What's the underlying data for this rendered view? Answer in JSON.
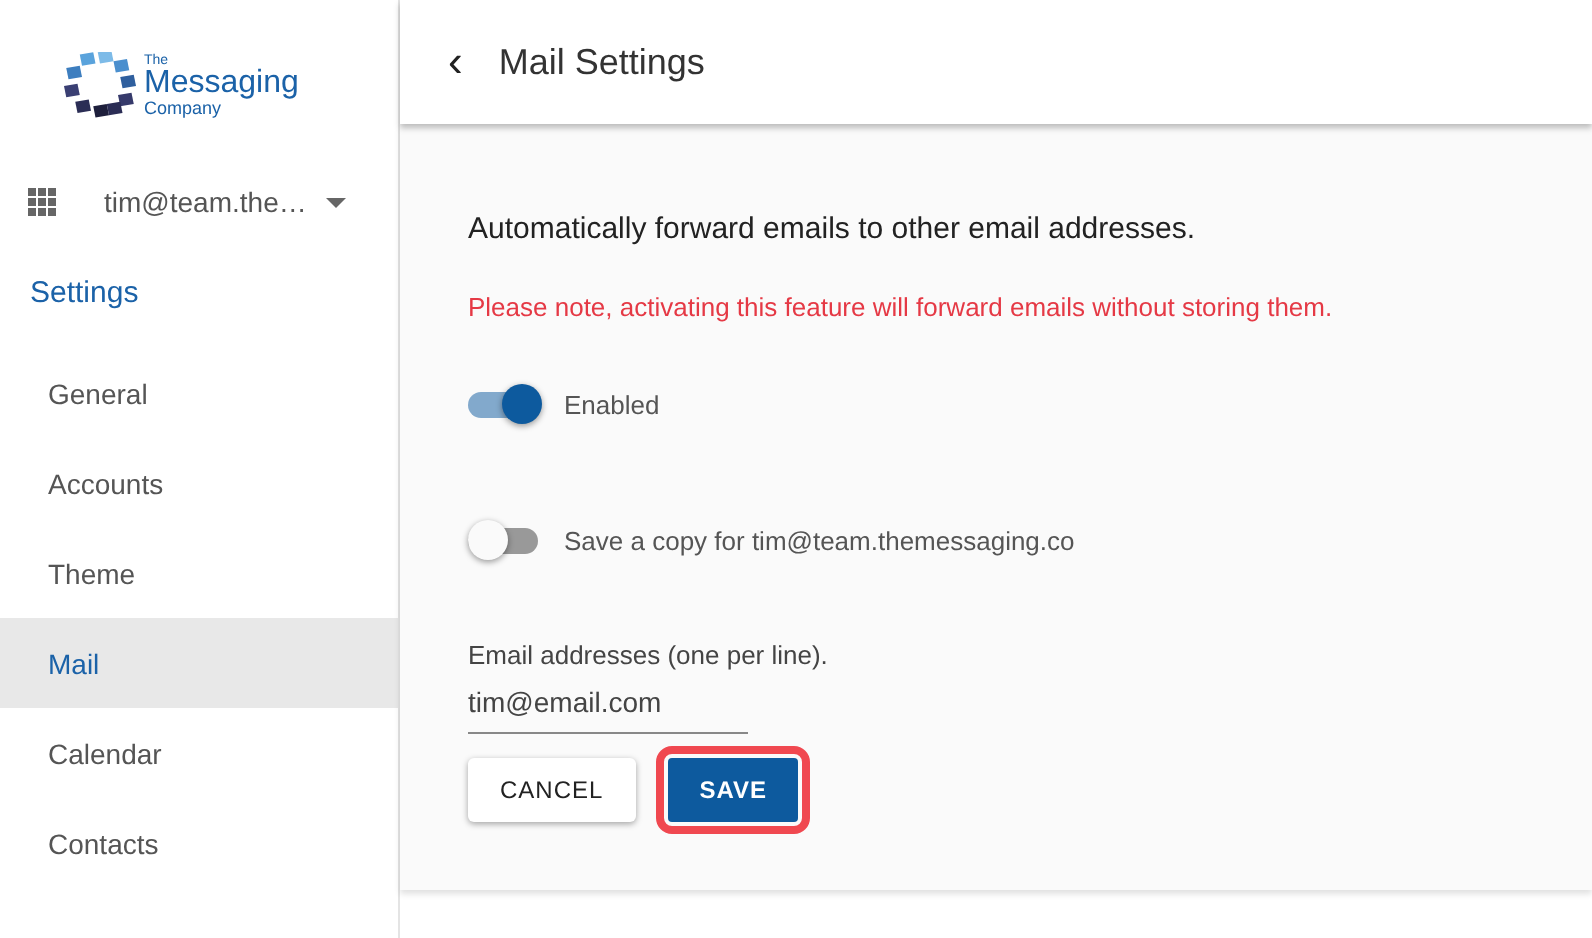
{
  "logo": {
    "lines": [
      "The",
      "Messaging",
      "Company"
    ]
  },
  "account": {
    "label": "tim@team.the…"
  },
  "sidebar": {
    "heading": "Settings",
    "items": [
      {
        "label": "General",
        "selected": false
      },
      {
        "label": "Accounts",
        "selected": false
      },
      {
        "label": "Theme",
        "selected": false
      },
      {
        "label": "Mail",
        "selected": true
      },
      {
        "label": "Calendar",
        "selected": false
      },
      {
        "label": "Contacts",
        "selected": false
      }
    ]
  },
  "header": {
    "back": "‹",
    "title": "Mail Settings"
  },
  "content": {
    "heading": "Automatically forward emails to other email addresses.",
    "warning": "Please note, activating this feature will forward emails without storing them.",
    "toggles": [
      {
        "label": "Enabled",
        "on": true
      },
      {
        "label": "Save a copy for tim@team.themessaging.co",
        "on": false
      }
    ],
    "field": {
      "label": "Email addresses (one per line).",
      "value": "tim@email.com"
    },
    "buttons": [
      {
        "label": "CANCEL",
        "kind": "outlined",
        "highlighted": false
      },
      {
        "label": "SAVE",
        "kind": "primary",
        "highlighted": true
      }
    ]
  }
}
